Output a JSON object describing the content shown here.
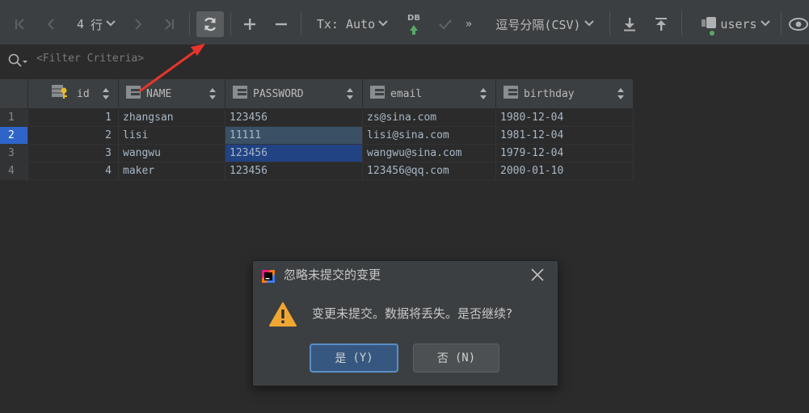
{
  "toolbar": {
    "page_size_value": "4",
    "page_size_unit": "行",
    "tx_label": "Tx: Auto",
    "db_label": "DB",
    "export_format": "逗号分隔(CSV)",
    "table_name": "users"
  },
  "filter": {
    "placeholder": "<Filter Criteria>"
  },
  "table": {
    "columns": [
      "id",
      "NAME",
      "PASSWORD",
      "email",
      "birthday"
    ],
    "rows": [
      {
        "num": "1",
        "id": "1",
        "name": "zhangsan",
        "password": "123456",
        "email": "zs@sina.com",
        "birthday": "1980-12-04"
      },
      {
        "num": "2",
        "id": "2",
        "name": "lisi",
        "password": "11111",
        "email": "lisi@sina.com",
        "birthday": "1981-12-04"
      },
      {
        "num": "3",
        "id": "3",
        "name": "wangwu",
        "password": "123456",
        "email": "wangwu@sina.com",
        "birthday": "1979-12-04"
      },
      {
        "num": "4",
        "id": "4",
        "name": "maker",
        "password": "123456",
        "email": "123456@qq.com",
        "birthday": "2000-01-10"
      }
    ],
    "selected_row": 2,
    "selected_cell": "row 3 / PASSWORD"
  },
  "dialog": {
    "title": "忽略未提交的变更",
    "message": "变更未提交。数据将丢失。是否继续?",
    "yes_label": "是",
    "yes_mnemonic": "(Y)",
    "no_label": "否",
    "no_mnemonic": "(N)"
  },
  "colors": {
    "background": "#2b2b2b",
    "toolbar": "#3c3f41",
    "selection": "#214283",
    "highlight": "#3a5064",
    "warning": "#f0a732",
    "annotation_arrow": "#e8352b"
  }
}
